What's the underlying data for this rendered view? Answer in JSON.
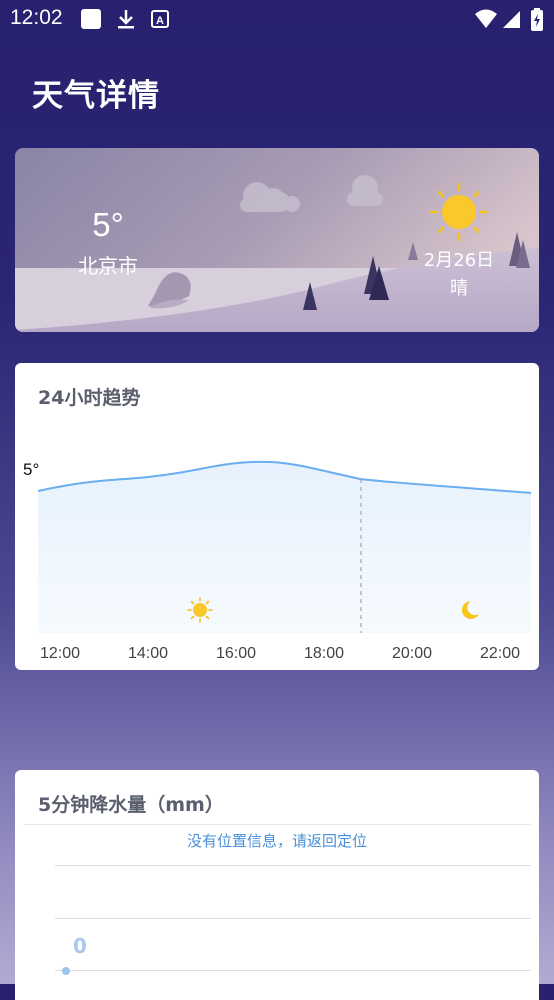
{
  "status_bar": {
    "time": "12:02",
    "icons": [
      "square-notification-icon",
      "download-icon",
      "a-box-icon",
      "wifi-icon",
      "signal-icon",
      "battery-charging-icon"
    ]
  },
  "page": {
    "title": "天气详情"
  },
  "current": {
    "temperature": "5°",
    "city": "北京市",
    "date": "2月26日",
    "condition": "晴"
  },
  "trend": {
    "title": "24小时趋势",
    "temp_label": "5°",
    "chart_data": {
      "type": "area",
      "title": "24小时趋势",
      "categories": [
        "12:00",
        "14:00",
        "16:00",
        "18:00",
        "20:00",
        "22:00"
      ],
      "series": [
        {
          "values": [
            5,
            5,
            5,
            5,
            5,
            5
          ]
        }
      ],
      "annotations": [
        "5°"
      ],
      "icons": [
        {
          "at": "16:00",
          "icon": "sun-icon"
        },
        {
          "at": "22:00",
          "icon": "moon-icon"
        }
      ],
      "divider_at": "19:00"
    }
  },
  "rain": {
    "title": "5分钟降水量（mm）",
    "message": "没有位置信息，请返回定位",
    "zero_label": "0"
  },
  "colors": {
    "bg_top": "#27216f",
    "bg_bottom": "#b1abd3",
    "line": "#6aaef0",
    "fill": "#eaf5fe",
    "link": "#4a90d9",
    "sun": "#f9c51b"
  }
}
